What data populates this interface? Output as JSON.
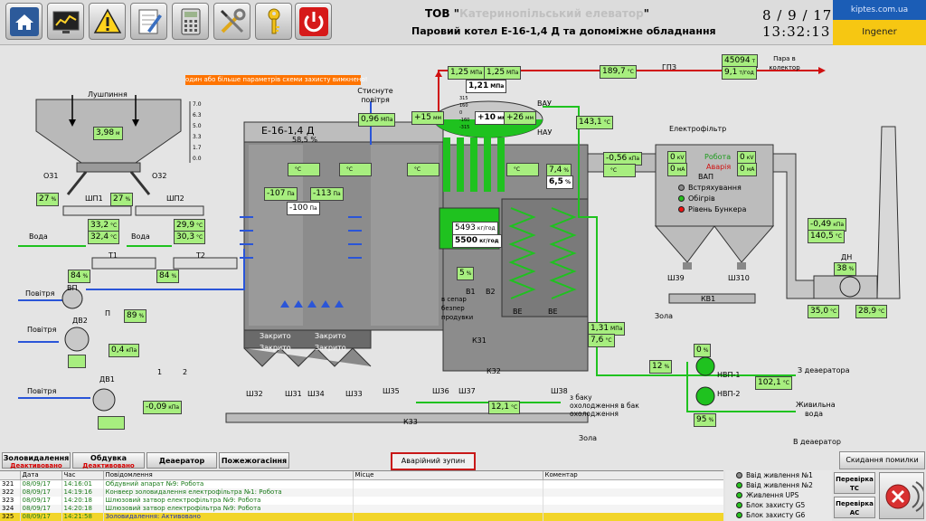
{
  "header": {
    "company_prefix": "ТОВ",
    "company_quote_open": "\"",
    "company_name": "Катеринопільський елеватор",
    "company_quote_close": "\"",
    "subtitle": "Паровий котел Е-16-1,4 Д та допоміжне обладнання",
    "date": "8 / 9 / 17",
    "time": "13:32:13",
    "site": "kiptes.com.ua",
    "user": "Ingener",
    "toolbar_icons": [
      "home-icon",
      "trend-monitor-icon",
      "warning-icon",
      "notepad-icon",
      "calculator-icon",
      "tools-icon",
      "key-icon",
      "power-icon"
    ]
  },
  "alarm_text": "один або більше параметрів схеми захисту вимкнено!",
  "labels": {
    "husk": "Лушпиння",
    "boiler": "Е-16-1,4 Д",
    "boiler_load": "58,5",
    "boiler_load_unit": "%",
    "compressed_air": "Стиснуте повітря",
    "water": "Вода",
    "air1": "Повітря",
    "air2": "Повітря",
    "air3": "Повітря",
    "steam_to_collector": "Пара в колектор",
    "electrofilter": "Електрофільтр",
    "vap": "ВАП",
    "run": "Робота",
    "fault": "Аварія",
    "shaking": "Встряхування",
    "heating": "Обігрів",
    "hopper_level": "Рівень Бункера",
    "blowdown": "в сепар безпер продувки",
    "to_deaerator3": "З деаератора",
    "feed_water": "Живильна вода",
    "to_deaerator": "В деаератор",
    "cooling_tank": "з баку охолодження в бак охолодження",
    "ash1": "Зола",
    "ash2": "Зола",
    "vau": "ВАУ",
    "nau": "НАУ",
    "ve1": "ВЕ",
    "ve2": "ВЕ",
    "closed": "Закрито",
    "tags": {
      "o31": "О31",
      "o32": "О32",
      "shp1": "ШП1",
      "shp2": "ШП2",
      "t1": "Т1",
      "t2": "Т2",
      "vp": "ВП",
      "dv2": "ДВ2",
      "dv1": "ДВ1",
      "p": "П",
      "gpz": "ГПЗ",
      "dn": "ДН",
      "kv1": "КВ1",
      "k31": "К31",
      "k32": "К32",
      "k33": "К33",
      "b1": "В1",
      "b2": "В2",
      "sh32": "Ш32",
      "sh31": "Ш31",
      "sh34": "Ш34",
      "sh33": "Ш33",
      "sh35": "Ш35",
      "sh36": "Ш36",
      "sh37": "Ш37",
      "sh38": "Ш38",
      "sh39": "Ш39",
      "sh310": "Ш310",
      "nvp1": "НВП-1",
      "nvp2": "НВП-2",
      "v1": "1",
      "v2": "2"
    },
    "level_scale": [
      "7.0",
      "6.3",
      "5.0",
      "3.3",
      "1.7",
      "0.0"
    ],
    "drum_scale": [
      "315",
      "160",
      "0",
      "-160",
      "-315"
    ]
  },
  "values": {
    "hopper_level": "3,98",
    "hopper_unit": "м",
    "shp1_pct": "27",
    "shp2_pct": "27",
    "t1_pct": "84",
    "t2_pct": "84",
    "t1_a": "33,2",
    "t1_b": "32,4",
    "t2_a": "29,9",
    "t2_b": "30,3",
    "t_unit": "°C",
    "press_vac1": "-107",
    "press_vac2": "-113",
    "press_vac3": "-100",
    "pa": "Па",
    "comp_air": "0,96",
    "mpa": "МПа",
    "p_pct": "89",
    "air_kpa": "0,4",
    "kpa": "кПа",
    "dv1_kpa": "-0,09",
    "steam_p1": "1,25",
    "steam_p2": "1,25",
    "drum_p": "1,21",
    "steam_t": "189,7",
    "flow_total": "45094",
    "flow_unit": "т",
    "flow_rate": "9,1",
    "flow_rate_unit": "т/год",
    "drum_lvl1": "+15",
    "drum_lvl2": "+10",
    "drum_lvl3": "+26",
    "mm": "мм",
    "drum_t": "143,1",
    "ve_kpa": "-0,56",
    "o2": "7,4",
    "o2b": "6,5",
    "pct": "%",
    "flow_5493": "5493",
    "flow_5493_unit": "кг/год",
    "flow_5500": "5500",
    "flow_5500_unit": "кг/год",
    "blow_pct": "5",
    "ef_kv1": "0",
    "ef_kv2": "0",
    "kv": "кV",
    "ef_ma1": "0",
    "ef_ma2": "0",
    "ma": "мА",
    "dn_kpa": "-0,49",
    "dn_t": "140,5",
    "dn_pct": "38",
    "dn_t2": "35,0",
    "dn_t3": "28,9",
    "fw_p": "1,31",
    "fw_t": "7,6",
    "nvp_pct1": "0",
    "nvp_pct2": "95",
    "valve12": "12",
    "feed_t": "102,1",
    "cool_t": "12,1"
  },
  "tabs": [
    {
      "label": "Золовидалення",
      "state": "Деактивовано"
    },
    {
      "label": "Обдувка",
      "state": "Деактивовано"
    },
    {
      "label": "Деаератор",
      "state": ""
    },
    {
      "label": "Пожежогасіння",
      "state": ""
    }
  ],
  "emergency_stop": "Аварійний зупин",
  "reset_button": "Скидання помилки",
  "log": {
    "headers": [
      "",
      "Дата",
      "Час",
      "Повідомлення",
      "Місце",
      "Коментар"
    ],
    "rows": [
      {
        "n": "321",
        "date": "08/09/17",
        "time": "14:16:01",
        "msg": "Обдувний апарат №9: Робота"
      },
      {
        "n": "322",
        "date": "08/09/17",
        "time": "14:19:16",
        "msg": "Конвеєр золовидалення електрофільтра №1: Робота"
      },
      {
        "n": "323",
        "date": "08/09/17",
        "time": "14:20:18",
        "msg": "Шлюзовий затвор електрофільтра №9: Робота"
      },
      {
        "n": "324",
        "date": "08/09/17",
        "time": "14:20:18",
        "msg": "Шлюзовий затвор електрофільтра №9: Робота"
      },
      {
        "n": "325",
        "date": "08/09/17",
        "time": "14:21:58",
        "msg": "Золовидалення: Активовано"
      }
    ]
  },
  "status": [
    {
      "label": "Ввід живлення №1",
      "color": "#8a8a8a"
    },
    {
      "label": "Ввід живлення №2",
      "color": "#27c11e"
    },
    {
      "label": "Живлення UPS",
      "color": "#27c11e"
    },
    {
      "label": "Блок захисту G5",
      "color": "#27c11e"
    },
    {
      "label": "Блок захисту G6",
      "color": "#27c11e"
    }
  ],
  "check_tc": "Перевірка ТС",
  "check_ac": "Перевірка АС",
  "colors": {
    "water_green": "#1fc21f",
    "air_blue": "#2a55d8",
    "steam_red": "#d01010",
    "value_green": "#a7ee7f"
  }
}
